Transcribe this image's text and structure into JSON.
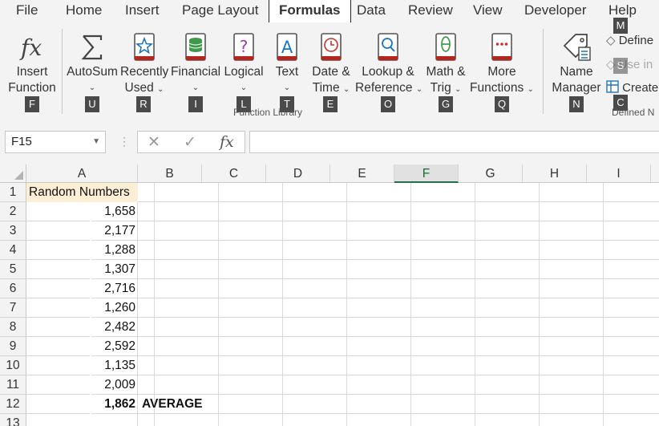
{
  "tabs": [
    "File",
    "Home",
    "Insert",
    "Page Layout",
    "Formulas",
    "Data",
    "Review",
    "View",
    "Developer",
    "Help"
  ],
  "active_tab": "Formulas",
  "ribbon": {
    "insert_function": {
      "line1": "Insert",
      "line2": "Function",
      "key": "F",
      "icon": "fx-icon"
    },
    "autosum": {
      "line1": "AutoSum",
      "key": "U",
      "icon": "sigma-icon"
    },
    "recently_used": {
      "line1": "Recently",
      "line2": "Used",
      "key": "R",
      "icon": "star-book-icon"
    },
    "financial": {
      "line1": "Financial",
      "key": "I",
      "icon": "coins-book-icon"
    },
    "logical": {
      "line1": "Logical",
      "key": "L",
      "icon": "question-book-icon"
    },
    "text": {
      "line1": "Text",
      "key": "T",
      "icon": "letter-a-book-icon"
    },
    "date_time": {
      "line1": "Date &",
      "line2": "Time",
      "key": "E",
      "icon": "clock-book-icon"
    },
    "lookup": {
      "line1": "Lookup &",
      "line2": "Reference",
      "key": "O",
      "icon": "magnifier-book-icon"
    },
    "math_trig": {
      "line1": "Math &",
      "line2": "Trig",
      "key": "G",
      "icon": "theta-book-icon"
    },
    "more_functions": {
      "line1": "More",
      "line2": "Functions",
      "key": "Q",
      "icon": "dots-book-icon"
    },
    "function_library_label": "Function Library",
    "name_manager": {
      "line1": "Name",
      "line2": "Manager",
      "key": "N",
      "icon": "tag-icon"
    },
    "define_name": {
      "label": "Define",
      "key": "M"
    },
    "use_in_formula": {
      "label": "Use in",
      "key": "S"
    },
    "create_from_selection": {
      "label": "Create",
      "key": "C"
    },
    "defined_names_label": "Defined N"
  },
  "formula_bar": {
    "name_box": "F15",
    "cancel_icon": "✕",
    "enter_icon": "✓",
    "fx_label": "fx",
    "formula": ""
  },
  "columns": [
    "A",
    "B",
    "C",
    "D",
    "E",
    "F",
    "G",
    "H",
    "I"
  ],
  "selected_column": "F",
  "rows": [
    "1",
    "2",
    "3",
    "4",
    "5",
    "6",
    "7",
    "8",
    "9",
    "10",
    "11",
    "12",
    "13"
  ],
  "sheet": {
    "a1": "Random Numbers",
    "values": [
      "1,658",
      "2,177",
      "1,288",
      "1,307",
      "2,716",
      "1,260",
      "2,482",
      "2,592",
      "1,135",
      "2,009"
    ],
    "a12": "1,862",
    "b12": "AVERAGE"
  },
  "colors": {
    "header_fill": "#fdeed6",
    "accent": "#217346"
  }
}
